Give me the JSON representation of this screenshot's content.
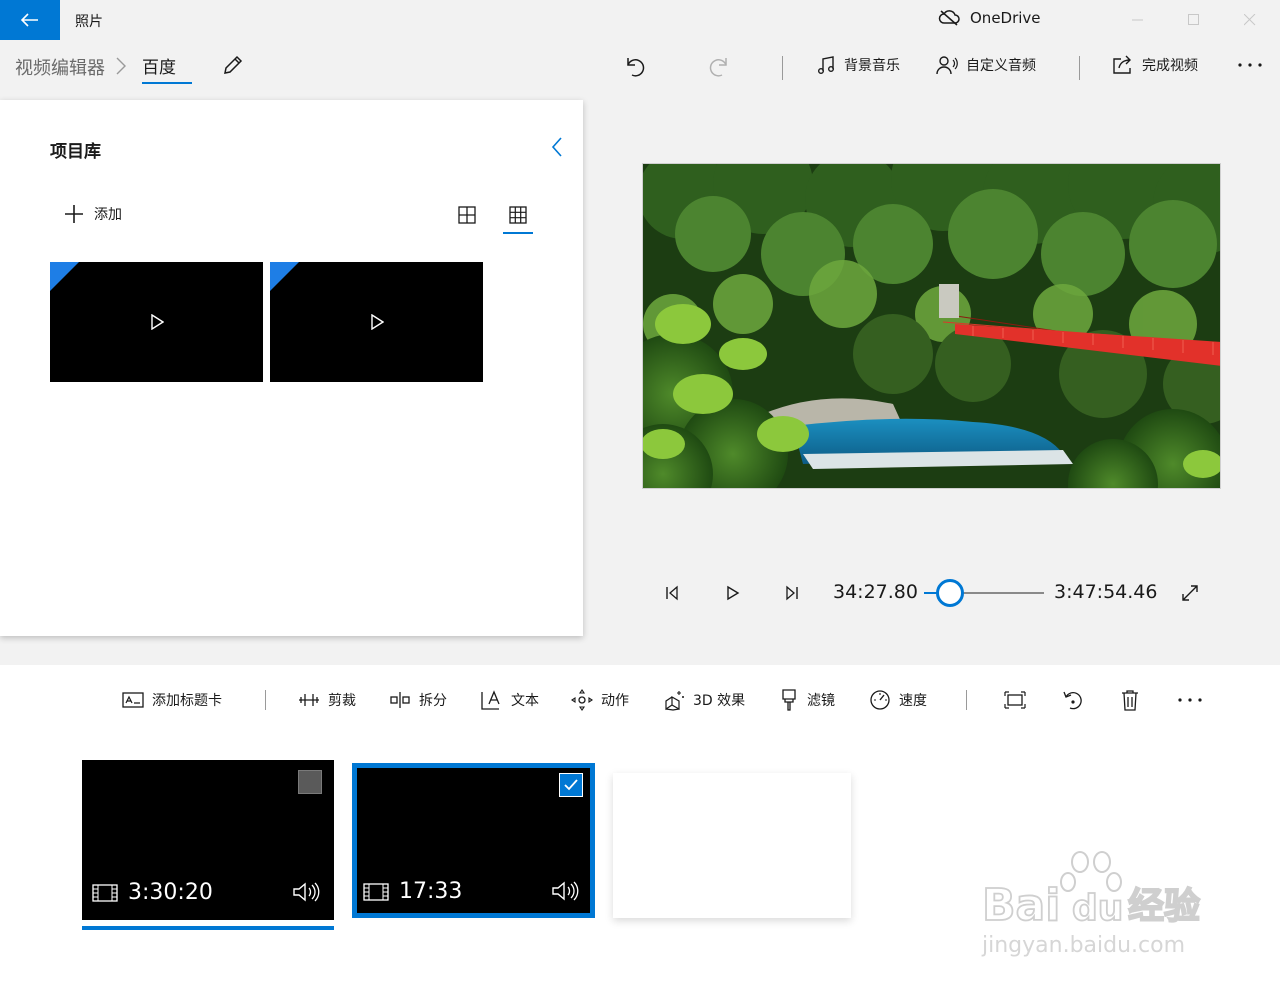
{
  "titlebar": {
    "app_title": "照片",
    "onedrive_label": "OneDrive"
  },
  "breadcrumb": {
    "root": "视频编辑器",
    "current": "百度"
  },
  "toolbar": {
    "background_music": "背景音乐",
    "custom_audio": "自定义音频",
    "finish_video": "完成视频"
  },
  "library": {
    "title": "项目库",
    "add_label": "添加",
    "items_count": 2
  },
  "playback": {
    "current_time": "34:27.80",
    "total_time": "3:47:54.46",
    "progress_fraction": 0.22
  },
  "storyboard_tools": {
    "add_title_card": "添加标题卡",
    "trim": "剪裁",
    "split": "拆分",
    "text": "文本",
    "motion": "动作",
    "effects_3d": "3D 效果",
    "filters": "滤镜",
    "speed": "速度"
  },
  "clips": [
    {
      "duration": "3:30:20",
      "selected": false
    },
    {
      "duration": "17:33",
      "selected": true
    }
  ],
  "watermark": {
    "brand_latin": "Bai",
    "brand_du": "du",
    "brand_cn": "经验",
    "url": "jingyan.baidu.com"
  },
  "colors": {
    "accent": "#0078d4",
    "library_corner": "#1e7ee6"
  }
}
